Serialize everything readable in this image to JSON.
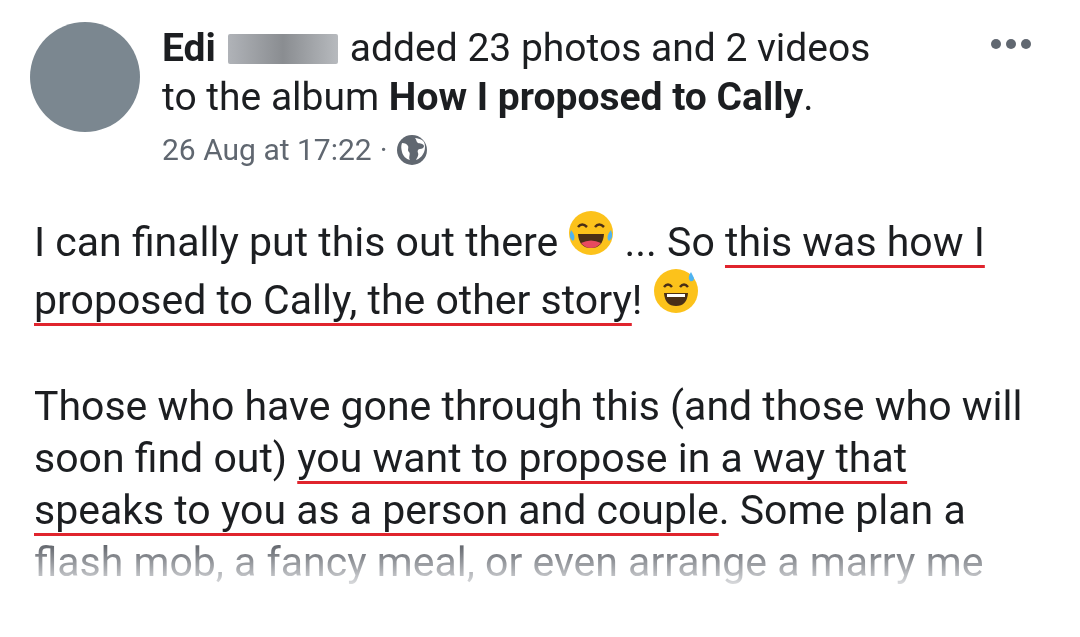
{
  "post": {
    "author": "Edi",
    "headline": "added 23 photos and 2 videos",
    "headline_2": "to the album **How I proposed to Cally**.",
    "time": "26 Aug at 17:22",
    "separator": "·"
  },
  "body": [
    {
      "lines": [
        [
          {
            "kind": "text",
            "text": "I can finally put this out there ",
            "underlined": false
          },
          {
            "kind": "laugh_emoji"
          },
          {
            "kind": "text",
            "text": " ... So ",
            "underlined": false
          },
          {
            "kind": "text",
            "text": "this was how I",
            "underlined": true
          }
        ],
        [
          {
            "kind": "text",
            "text": "proposed to Cally, the other story",
            "underlined": true
          },
          {
            "kind": "text",
            "text": "! ",
            "underlined": false
          },
          {
            "kind": "sweat_emoji"
          }
        ]
      ]
    },
    {
      "lines": [
        [
          {
            "kind": "text",
            "text": "Those who have gone through this (and those who will",
            "underlined": false
          }
        ],
        [
          {
            "kind": "text",
            "text": "soon find out) ",
            "underlined": false
          },
          {
            "kind": "text",
            "text": "you want to propose in a way that",
            "underlined": true
          }
        ],
        [
          {
            "kind": "text",
            "text": "speaks to you as a person and couple",
            "underlined": true
          },
          {
            "kind": "text",
            "text": ". Some plan a",
            "underlined": false
          }
        ],
        [
          {
            "kind": "text",
            "text": "flash mob, a fancy meal, or even arrange a marry me",
            "underlined": false,
            "faded": true
          }
        ]
      ]
    }
  ]
}
